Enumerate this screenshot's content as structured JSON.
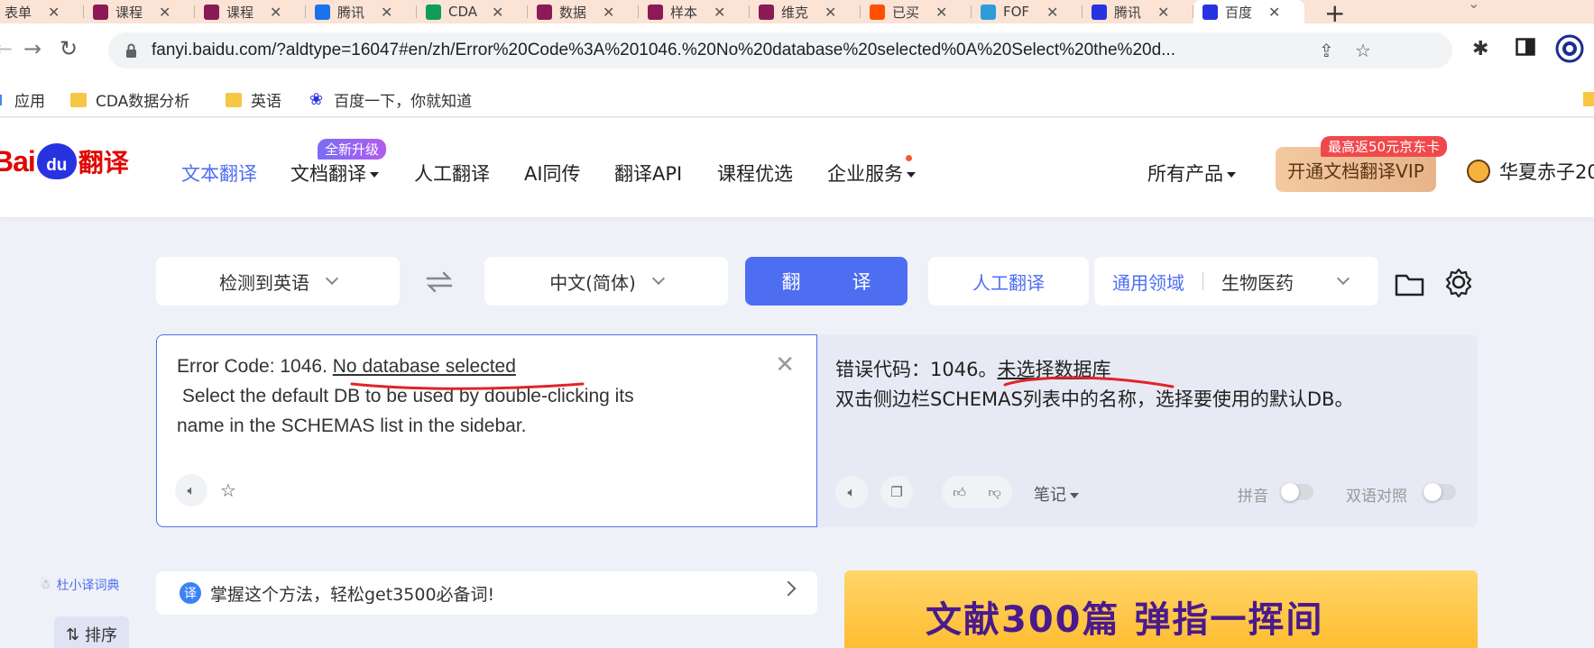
{
  "browser": {
    "tabs": [
      {
        "label": "表单",
        "color": "#4285f4"
      },
      {
        "label": "课程",
        "color": "#8b1a57"
      },
      {
        "label": "课程",
        "color": "#8b1a57"
      },
      {
        "label": "腾讯",
        "color": "#1a73e8"
      },
      {
        "label": "CDA",
        "color": "#0f9d58"
      },
      {
        "label": "数据",
        "color": "#8b1a57"
      },
      {
        "label": "样本",
        "color": "#8b1a57"
      },
      {
        "label": "维克",
        "color": "#8b1a57"
      },
      {
        "label": "已买",
        "color": "#ff5000"
      },
      {
        "label": "FOF",
        "color": "#2d9cdb"
      },
      {
        "label": "腾讯",
        "color": "#2932e1"
      },
      {
        "label": "百度",
        "color": "#2932e1",
        "active": true
      }
    ],
    "url": "fanyi.baidu.com/?aldtype=16047#en/zh/Error%20Code%3A%201046.%20No%20database%20selected%0A%20Select%20the%20d...",
    "bookmarks": [
      "应用",
      "CDA数据分析",
      "英语",
      "百度一下，你就知道"
    ]
  },
  "header": {
    "logo_bai": "Bai",
    "logo_du": "du",
    "logo_fy": "翻译",
    "nav": [
      "文本翻译",
      "文档翻译",
      "人工翻译",
      "AI同传",
      "翻译API",
      "课程优选",
      "企业服务"
    ],
    "new_badge": "全新升级",
    "all_products": "所有产品",
    "vip_button": "开通文档翻译VIP",
    "vip_tag": "最高返50元京东卡",
    "username": "华夏赤子20"
  },
  "controls": {
    "source_lang": "检测到英语",
    "target_lang": "中文(简体)",
    "translate_button": "翻　译",
    "human_translate": "人工翻译",
    "domain_general": "通用领域",
    "domain_selected": "生物医药"
  },
  "source": {
    "text_plain": "Error Code: 1046. ",
    "text_underlined": "No database selected",
    "text_rest": "\n Select the default DB to be used by double-clicking its\nname in the SCHEMAS list in the sidebar."
  },
  "target": {
    "text_plain": "错误代码：1046。",
    "text_underlined": "未选择数据库",
    "text_rest": "\n双击侧边栏SCHEMAS列表中的名称，选择要使用的默认DB。",
    "note_label": "笔记",
    "pinyin_label": "拼音",
    "bilingual_label": "双语对照"
  },
  "bottom": {
    "dict_link": "杜小译词典",
    "sort_button": "排序",
    "tip_icon": "译",
    "tip_text": "掌握这个方法，轻松get3500必备词!",
    "banner_text": "文献300篇  弹指一挥间"
  },
  "colors": {
    "accent": "#4e6ef2",
    "annotation_red": "#e0242a"
  }
}
